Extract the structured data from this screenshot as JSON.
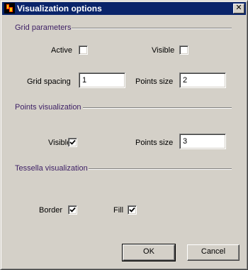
{
  "window": {
    "title": "Visualization options",
    "close_glyph": "✕"
  },
  "grid": {
    "section_label": "Grid parameters",
    "active_label": "Active",
    "active_checked": false,
    "visible_label": "Visible",
    "visible_checked": false,
    "spacing_label": "Grid spacing",
    "spacing_value": "1",
    "points_size_label": "Points size",
    "points_size_value": "2"
  },
  "points": {
    "section_label": "Points visualization",
    "visible_label": "Visible",
    "visible_checked": true,
    "points_size_label": "Points size",
    "points_size_value": "3"
  },
  "tessella": {
    "section_label": "Tessella visualization",
    "border_label": "Border",
    "border_checked": true,
    "fill_label": "Fill",
    "fill_checked": true
  },
  "buttons": {
    "ok_label": "OK",
    "cancel_label": "Cancel"
  },
  "colors": {
    "title_bar": "#0a246a",
    "section_text": "#3c1e64",
    "face": "#d4d0c8"
  },
  "icons": {
    "app": "app-logo-icon",
    "close": "close-icon",
    "check": "checkmark-icon"
  }
}
